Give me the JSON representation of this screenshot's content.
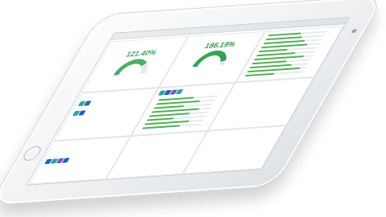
{
  "gauges": [
    {
      "value": "121.40%",
      "level": 0.75
    },
    {
      "value": "186.19%",
      "level": 0.9
    }
  ],
  "colors": {
    "accent": "#4caf50",
    "gauge_green": "#1f8a3a",
    "icon_teal": "#26a69a",
    "icon_blue": "#1e63b5",
    "icon_purple": "#7e57c2"
  },
  "right_bars": [
    0.55,
    0.62,
    0.7,
    0.78,
    0.48,
    0.66,
    0.84,
    0.58,
    0.72,
    0.9,
    0.5
  ],
  "middle_bars": [
    0.6,
    0.74,
    0.52,
    0.82,
    0.68,
    0.46,
    0.76,
    0.64
  ],
  "icons_right": [
    "teal",
    "blue",
    "purple",
    "teal"
  ],
  "icons_left_top": [
    "teal",
    "blue"
  ],
  "icons_left_bottom": [
    "blue",
    "teal",
    "purple",
    "blue"
  ]
}
